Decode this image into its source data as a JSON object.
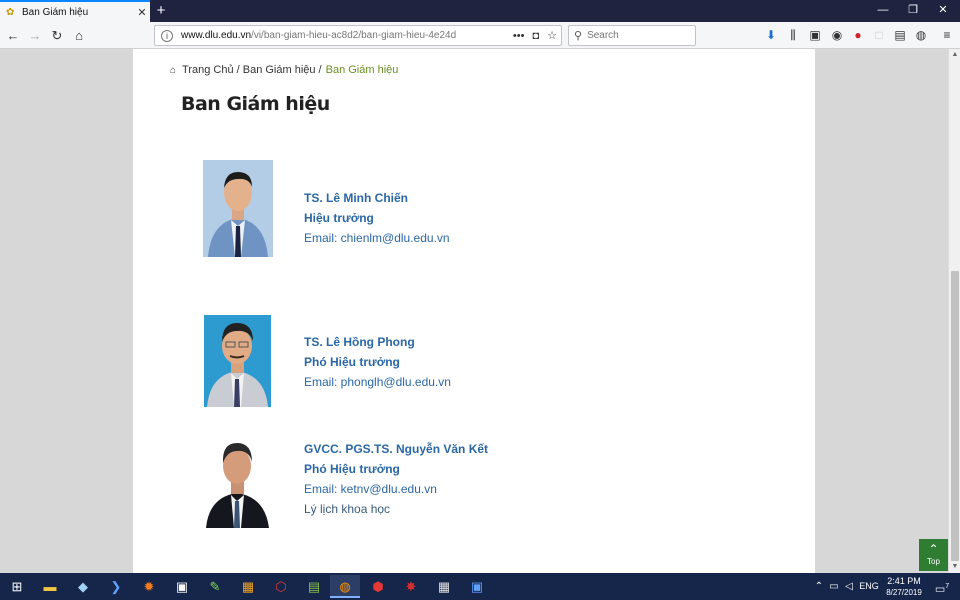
{
  "browser": {
    "tab": {
      "title": "Ban Giám hiệu",
      "close": "✕"
    },
    "new_tab": "+",
    "window": {
      "minimize": "—",
      "restore": "❐",
      "close": "✕"
    },
    "url": {
      "host": "www.dlu.edu.vn",
      "path": "/vi/ban-giam-hieu-ac8d2/ban-giam-hieu-4e24d",
      "more": "•••"
    },
    "search": {
      "placeholder": "Search"
    }
  },
  "breadcrumb": {
    "items": [
      "Trang Chủ /",
      "Ban Giám hiệu /"
    ],
    "current": "Ban Giám hiệu"
  },
  "page_title": "Ban Giám hiệu",
  "members": [
    {
      "name": "TS. Lê Minh Chiến",
      "role": "Hiệu trưởng",
      "email": "Email: chienlm@dlu.edu.vn"
    },
    {
      "name": "TS. Lê Hồng Phong",
      "role": "Phó Hiệu trưởng",
      "email": "Email: phonglh@dlu.edu.vn"
    },
    {
      "name": "GVCC. PGS.TS. Nguyễn Văn Kết",
      "role": "Phó Hiệu trưởng",
      "email": "Email: ketnv@dlu.edu.vn",
      "cv_link": "Lý lịch khoa học"
    }
  ],
  "back_to_top": {
    "label": "Top"
  },
  "taskbar": {
    "language": "ENG",
    "time": "2:41 PM",
    "date": "8/27/2019",
    "notifications": "7"
  },
  "colors": {
    "link": "#2a67a4",
    "breadcrumb_current": "#6b8e23",
    "back_to_top": "#2e7d32",
    "tab_accent": "#0a84ff"
  }
}
